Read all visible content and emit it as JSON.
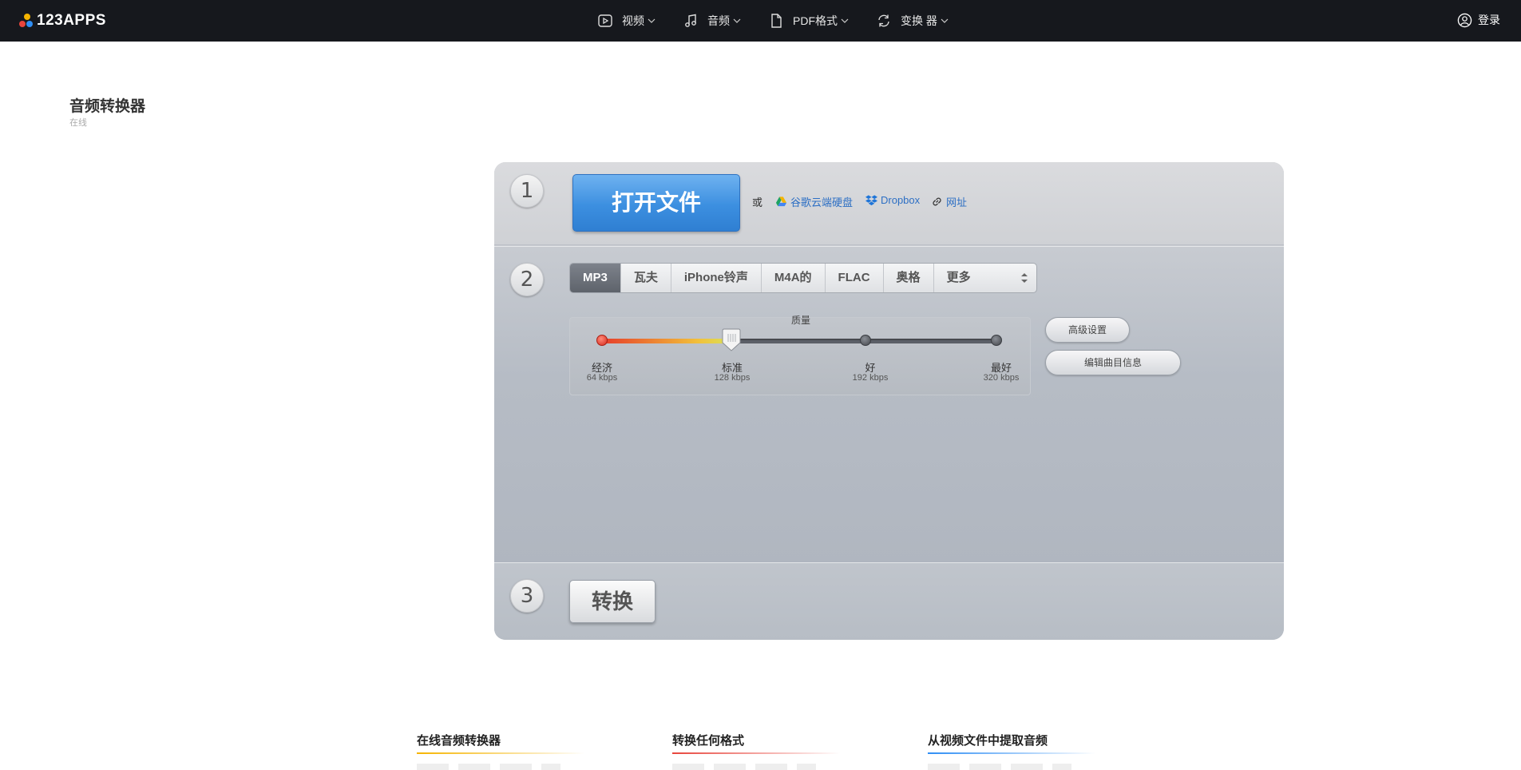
{
  "header": {
    "logo_text": "123APPS",
    "nav": [
      {
        "label": "视频",
        "icon": "video-icon"
      },
      {
        "label": "音频",
        "icon": "music-icon"
      },
      {
        "label": "PDF格式",
        "icon": "file-icon"
      },
      {
        "label": "变换 器",
        "icon": "refresh-icon"
      }
    ],
    "login_label": "登录"
  },
  "page": {
    "title": "音频转换器",
    "subtitle": "在线"
  },
  "step1": {
    "number": "1",
    "open_button": "打开文件",
    "or_text": "或",
    "sources": [
      {
        "label": "谷歌云端硬盘",
        "icon": "google-drive-icon"
      },
      {
        "label": "Dropbox",
        "icon": "dropbox-icon"
      },
      {
        "label": "网址",
        "icon": "link-icon"
      }
    ]
  },
  "step2": {
    "number": "2",
    "formats": [
      "MP3",
      "瓦夫",
      "iPhone铃声",
      "M4A的",
      "FLAC",
      "奥格",
      "更多"
    ],
    "selected_format": "MP3",
    "quality_label": "质量",
    "quality_levels": [
      {
        "name": "经济",
        "rate": "64 kbps"
      },
      {
        "name": "标准",
        "rate": "128 kbps"
      },
      {
        "name": "好",
        "rate": "192 kbps"
      },
      {
        "name": "最好",
        "rate": "320 kbps"
      }
    ],
    "selected_quality": "标准",
    "advanced_button": "高级设置",
    "edit_info_button": "编辑曲目信息"
  },
  "step3": {
    "number": "3",
    "convert_button": "转换"
  },
  "features": [
    {
      "title": "在线音频转换器",
      "accent": "#f5b400"
    },
    {
      "title": "转换任何格式",
      "accent": "#e8453c"
    },
    {
      "title": "从视频文件中提取音频",
      "accent": "#2f8ef4"
    }
  ],
  "colors": {
    "nav_bg": "#16181d",
    "open_button": "#3c8fe0",
    "link": "#2d6fc4"
  }
}
